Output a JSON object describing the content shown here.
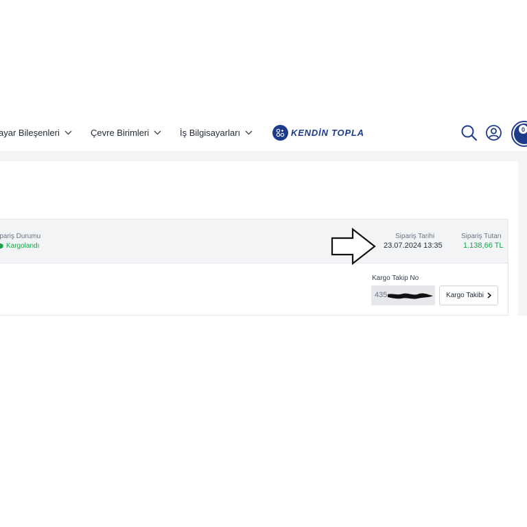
{
  "header": {
    "nav": [
      {
        "label": "ayar Bileşenleri"
      },
      {
        "label": "Çevre Birimleri"
      },
      {
        "label": "İş Bilgisayarları"
      }
    ],
    "logo_text": "KENDİN TOPLA",
    "cart_count": "0"
  },
  "order": {
    "status_label": "ipariş Durumu",
    "status_value": "Kargolandı",
    "date_label": "Sipariş Tarihi",
    "date_value": "23.07.2024 13:35",
    "total_label": "Sipariş Tutarı",
    "total_value": "1.138,66 TL",
    "tracking_label": "Kargo Takip No",
    "tracking_prefix": "435",
    "tracking_button_label": "Kargo Takibi",
    "colors": {
      "status": "#16a34a",
      "total": "#16a34a",
      "brand": "#1e3a8a"
    }
  }
}
